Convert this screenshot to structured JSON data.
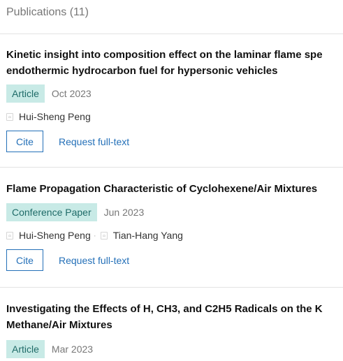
{
  "header": {
    "title": "Publications (11)"
  },
  "publications": [
    {
      "title": "Kinetic insight into composition effect on the laminar flame spe\nendothermic hydrocarbon fuel for hypersonic vehicles",
      "type": "Article",
      "date": "Oct 2023",
      "authors": [
        "Hui-Sheng Peng"
      ],
      "cite_label": "Cite",
      "request_label": "Request full-text"
    },
    {
      "title": "Flame Propagation Characteristic of Cyclohexene/Air Mixtures",
      "type": "Conference Paper",
      "date": "Jun 2023",
      "authors": [
        "Hui-Sheng Peng",
        "Tian-Hang Yang"
      ],
      "author_separator": "·",
      "cite_label": "Cite",
      "request_label": "Request full-text"
    },
    {
      "title": "Investigating the Effects of H, CH3, and C2H5 Radicals on the K\nMethane/Air Mixtures",
      "type": "Article",
      "date": "Mar 2023"
    }
  ],
  "colors": {
    "accent": "#2470b8",
    "badge_bg": "#c8eae6",
    "badge_text": "#1f6b68",
    "muted": "#777777"
  },
  "icons": {
    "author": "author-avatar-icon"
  }
}
